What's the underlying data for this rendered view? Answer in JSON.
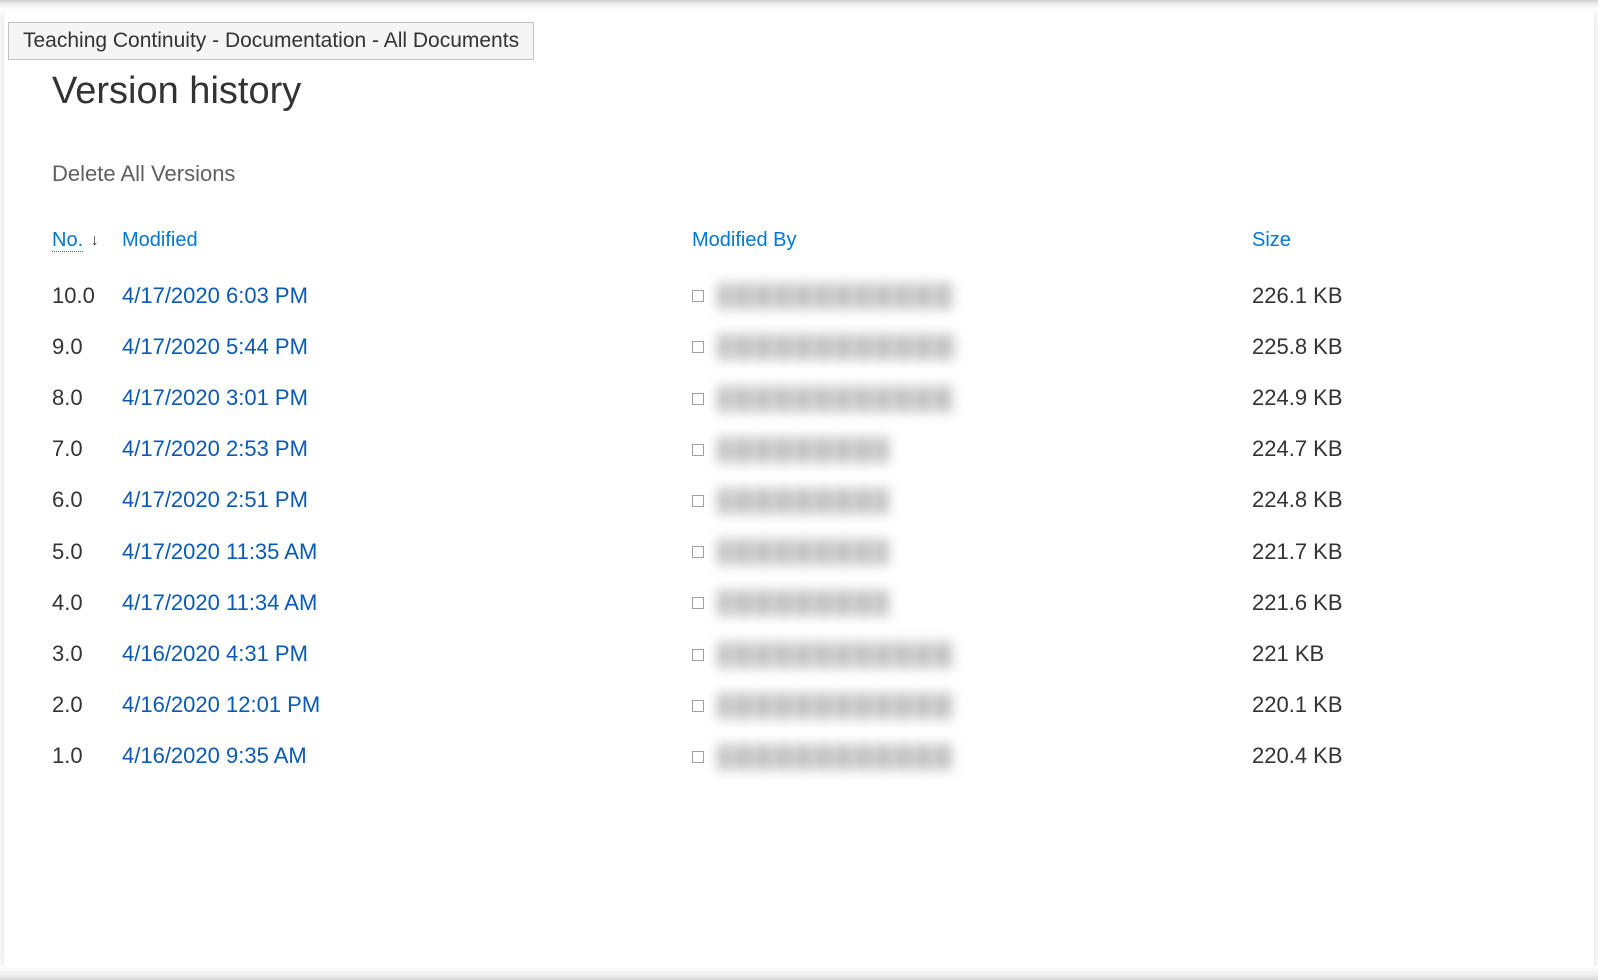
{
  "tooltip": "Teaching Continuity - Documentation - All Documents",
  "page_title": "Version history",
  "delete_all_label": "Delete All Versions",
  "columns": {
    "no": "No.",
    "modified": "Modified",
    "modified_by": "Modified By",
    "size": "Size"
  },
  "versions": [
    {
      "no": "10.0",
      "modified": "4/17/2020 6:03 PM",
      "by_width": 235,
      "size": "226.1 KB"
    },
    {
      "no": "9.0",
      "modified": "4/17/2020 5:44 PM",
      "by_width": 238,
      "size": "225.8 KB"
    },
    {
      "no": "8.0",
      "modified": "4/17/2020 3:01 PM",
      "by_width": 235,
      "size": "224.9 KB"
    },
    {
      "no": "7.0",
      "modified": "4/17/2020 2:53 PM",
      "by_width": 170,
      "size": "224.7 KB"
    },
    {
      "no": "6.0",
      "modified": "4/17/2020 2:51 PM",
      "by_width": 170,
      "size": "224.8 KB"
    },
    {
      "no": "5.0",
      "modified": "4/17/2020 11:35 AM",
      "by_width": 170,
      "size": "221.7 KB"
    },
    {
      "no": "4.0",
      "modified": "4/17/2020 11:34 AM",
      "by_width": 170,
      "size": "221.6 KB"
    },
    {
      "no": "3.0",
      "modified": "4/16/2020 4:31 PM",
      "by_width": 235,
      "size": "221 KB"
    },
    {
      "no": "2.0",
      "modified": "4/16/2020 12:01 PM",
      "by_width": 235,
      "size": "220.1 KB"
    },
    {
      "no": "1.0",
      "modified": "4/16/2020 9:35 AM",
      "by_width": 235,
      "size": "220.4 KB"
    }
  ]
}
